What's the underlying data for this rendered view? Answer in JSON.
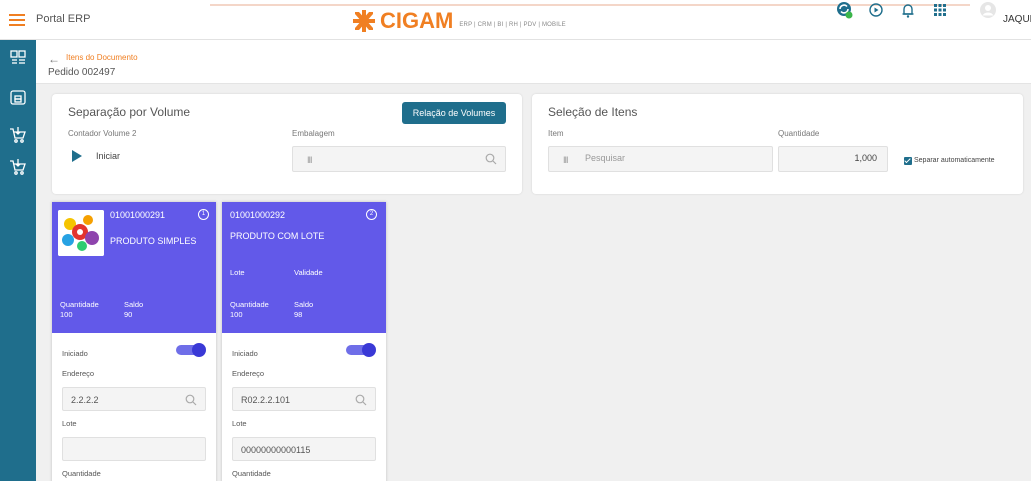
{
  "topbar": {
    "portal_title": "Portal ERP",
    "logo_text": "CIGAM",
    "logo_tagline": "ERP | CRM | BI | RH | PDV | MOBILE",
    "user_name": "JAQUE",
    "brand_color": "#f07f22",
    "icons": [
      "hamburger-icon",
      "sync-icon",
      "play-circle-icon",
      "bell-icon",
      "apps-grid-icon",
      "user-avatar-icon"
    ]
  },
  "sidebar": {
    "color": "#1f6e8c",
    "items": [
      {
        "icon": "document-list-icon"
      },
      {
        "icon": "warehouse-icon"
      },
      {
        "icon": "cart-icon"
      },
      {
        "icon": "cart-icon"
      }
    ]
  },
  "subheader": {
    "breadcrumb": "Itens do Documento",
    "title": "Pedido 002497"
  },
  "volume_panel": {
    "title": "Separação por Volume",
    "relation_button": "Relação de Volumes",
    "counter_label": "Contador Volume 2",
    "start_label": "Iniciar",
    "packaging_label": "Embalagem",
    "packaging_value": ""
  },
  "item_panel": {
    "title": "Seleção de Itens",
    "item_label": "Item",
    "item_placeholder": "Pesquisar",
    "quantity_label": "Quantidade",
    "quantity_value": "1,000",
    "auto_separate_label": "Separar automaticamente",
    "auto_separate_checked": true
  },
  "cards": [
    {
      "code": "01001000291",
      "index": "1",
      "name": "PRODUTO SIMPLES",
      "has_image": true,
      "lot_label": "",
      "validity_label": "",
      "quantity_label": "Quantidade",
      "quantity_value": "100",
      "balance_label": "Saldo",
      "balance_value": "90",
      "started_label": "Iniciado",
      "started": true,
      "address_label": "Endereço",
      "address_value": "2.2.2.2",
      "lot_field_label": "Lote",
      "lot_field_value": "",
      "qty_field_label": "Quantidade"
    },
    {
      "code": "01001000292",
      "index": "2",
      "name": "PRODUTO COM LOTE",
      "has_image": false,
      "lot_label": "Lote",
      "validity_label": "Validade",
      "quantity_label": "Quantidade",
      "quantity_value": "100",
      "balance_label": "Saldo",
      "balance_value": "98",
      "started_label": "Iniciado",
      "started": true,
      "address_label": "Endereço",
      "address_value": "R02.2.2.101",
      "lot_field_label": "Lote",
      "lot_field_value": "00000000000115",
      "qty_field_label": "Quantidade"
    }
  ],
  "card_color": "#6259e9"
}
